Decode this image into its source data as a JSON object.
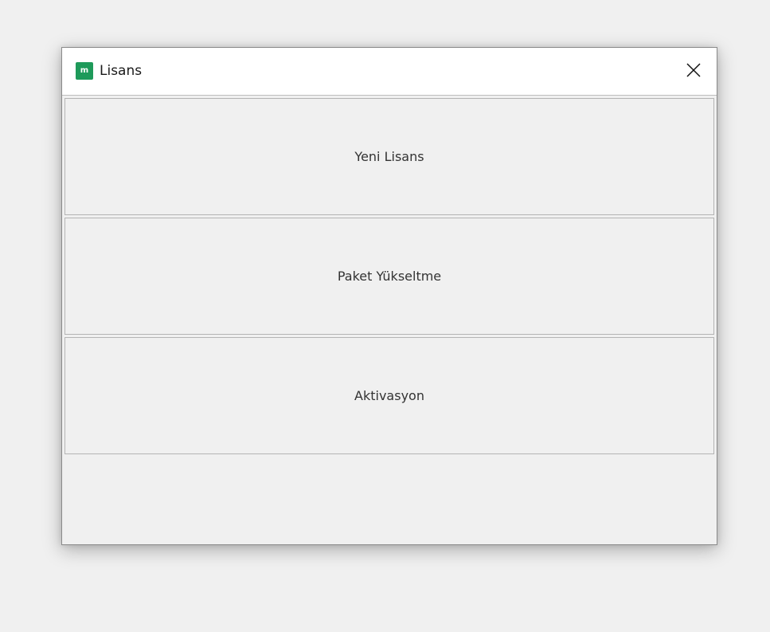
{
  "window": {
    "title": "Lisans",
    "app_icon_glyph": "m",
    "app_icon_color": "#1e9a5a",
    "close_icon": "close-icon"
  },
  "buttons": [
    {
      "label": "Yeni Lisans"
    },
    {
      "label": "Paket Yükseltme"
    },
    {
      "label": "Aktivasyon"
    }
  ]
}
